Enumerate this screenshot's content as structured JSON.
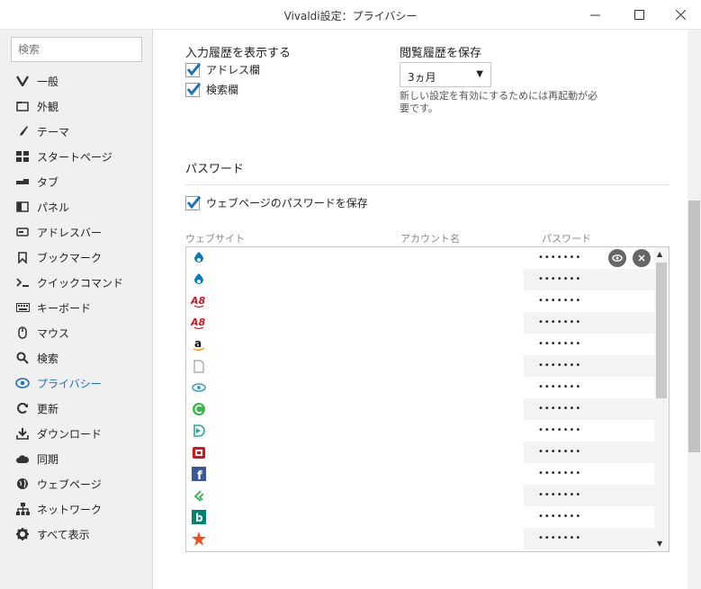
{
  "window": {
    "title": "Vivaldi設定：プライバシー"
  },
  "sidebar": {
    "search_placeholder": "検索",
    "items": [
      {
        "label": "一般",
        "icon": "vivaldi-icon"
      },
      {
        "label": "外観",
        "icon": "folder-icon"
      },
      {
        "label": "テーマ",
        "icon": "brush-icon"
      },
      {
        "label": "スタートページ",
        "icon": "grid-icon"
      },
      {
        "label": "タブ",
        "icon": "tab-icon"
      },
      {
        "label": "パネル",
        "icon": "panel-icon"
      },
      {
        "label": "アドレスバー",
        "icon": "addressbar-icon"
      },
      {
        "label": "ブックマーク",
        "icon": "bookmark-icon"
      },
      {
        "label": "クイックコマンド",
        "icon": "quick-command-icon"
      },
      {
        "label": "キーボード",
        "icon": "keyboard-icon"
      },
      {
        "label": "マウス",
        "icon": "mouse-icon"
      },
      {
        "label": "検索",
        "icon": "search-icon"
      },
      {
        "label": "プライバシー",
        "icon": "eye-icon",
        "active": true
      },
      {
        "label": "更新",
        "icon": "refresh-icon"
      },
      {
        "label": "ダウンロード",
        "icon": "download-icon"
      },
      {
        "label": "同期",
        "icon": "cloud-icon"
      },
      {
        "label": "ウェブページ",
        "icon": "globe-icon"
      },
      {
        "label": "ネットワーク",
        "icon": "network-icon"
      },
      {
        "label": "すべて表示",
        "icon": "gear-icon"
      }
    ]
  },
  "history": {
    "show_title": "入力履歴を表示する",
    "address_label": "アドレス欄",
    "search_label": "検索欄",
    "save_title": "閲覧履歴を保存",
    "save_value": "3ヵ月",
    "restart_note": "新しい設定を有効にするためには再起動が必要です。"
  },
  "passwords": {
    "section_title": "パスワード",
    "save_label": "ウェブページのパスワードを保存",
    "columns": {
      "website": "ウェブサイト",
      "account": "アカウント名",
      "password": "パスワード"
    },
    "rows": [
      {
        "icon": "drupal-icon",
        "password": "•••••••"
      },
      {
        "icon": "drupal-icon",
        "password": "•••••••"
      },
      {
        "icon": "a8-icon",
        "password": "•••••••"
      },
      {
        "icon": "a8-icon",
        "password": "•••••••"
      },
      {
        "icon": "amazon-icon",
        "password": "•••••••"
      },
      {
        "icon": "page-icon",
        "password": "•••••••"
      },
      {
        "icon": "eye-logo-icon",
        "password": "•••••••"
      },
      {
        "icon": "green-circle-icon",
        "password": "•••••••"
      },
      {
        "icon": "d-logo-icon",
        "password": "•••••••"
      },
      {
        "icon": "red-logo-icon",
        "password": "•••••••"
      },
      {
        "icon": "facebook-icon",
        "password": "•••••••"
      },
      {
        "icon": "feedly-icon",
        "password": "•••••••"
      },
      {
        "icon": "bing-icon",
        "password": "•••••••"
      },
      {
        "icon": "star-icon",
        "password": "•••••••"
      }
    ]
  },
  "colors": {
    "accent": "#1e73be"
  }
}
